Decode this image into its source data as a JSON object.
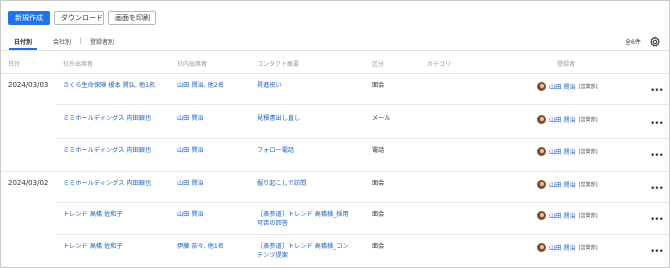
{
  "toolbar": {
    "new_label": "新規作成",
    "download_label": "ダウンロード",
    "print_label": "画面を印刷"
  },
  "tabs": [
    {
      "label": "日付別"
    },
    {
      "label": "会社別"
    },
    {
      "label": "登録者別"
    }
  ],
  "total_count": "全6件",
  "columns": {
    "date": "日付",
    "external": "社外出席者",
    "internal": "社内出席者",
    "summary": "コンタクト概要",
    "kind": "区分",
    "category": "カテゴリ",
    "registrant": "登録者"
  },
  "rows": [
    {
      "date": "2024/03/03",
      "external": "さくら生命保険 榎本 賢弘, 他1名",
      "internal": "山田 賢治, 他2名",
      "summary": [
        "昇進祝い"
      ],
      "kind": "面会",
      "category": "",
      "registrant": "山田 賢治",
      "dept": "[営業部]"
    },
    {
      "date": "",
      "external": "ミミホールディングス 内田銀也",
      "internal": "山田 賢治",
      "summary": [
        "見積書出し直し"
      ],
      "kind": "メール",
      "category": "",
      "registrant": "山田 賢治",
      "dept": "[営業部]"
    },
    {
      "date": "",
      "external": "ミミホールディングス 内田銀也",
      "internal": "山田 賢治",
      "summary": [
        "フォロー電話"
      ],
      "kind": "電話",
      "category": "",
      "registrant": "山田 賢治",
      "dept": "[営業部]"
    },
    {
      "date": "2024/03/02",
      "external": "ミミホールディングス 内田銀也",
      "internal": "山田 賢治",
      "summary": [
        "掘り起こしで訪問"
      ],
      "kind": "面会",
      "category": "",
      "registrant": "山田 賢治",
      "dept": "[営業部]"
    },
    {
      "date": "",
      "external": "トレンド 高橋 佐和子",
      "internal": "山田 賢治",
      "summary": [
        "［表参道］トレンド 高橋様_採用",
        "可否の回答"
      ],
      "kind": "面会",
      "category": "",
      "registrant": "山田 賢治",
      "dept": "[営業部]"
    },
    {
      "date": "",
      "external": "トレンド 高橋 佐和子",
      "internal": "伊藤 奈々, 他1名",
      "summary": [
        "［表参道］トレンド 高橋様_コン",
        "テンツ提案"
      ],
      "kind": "面会",
      "category": "",
      "registrant": "山田 賢治",
      "dept": "[営業部]"
    }
  ],
  "icons": {
    "settings": "gear-icon",
    "row_menu": "more-horizontal-icon",
    "avatar": "user-avatar"
  },
  "colors": {
    "primary": "#1f73e8",
    "link": "#1a5fb4",
    "border": "#e6e6e6"
  }
}
